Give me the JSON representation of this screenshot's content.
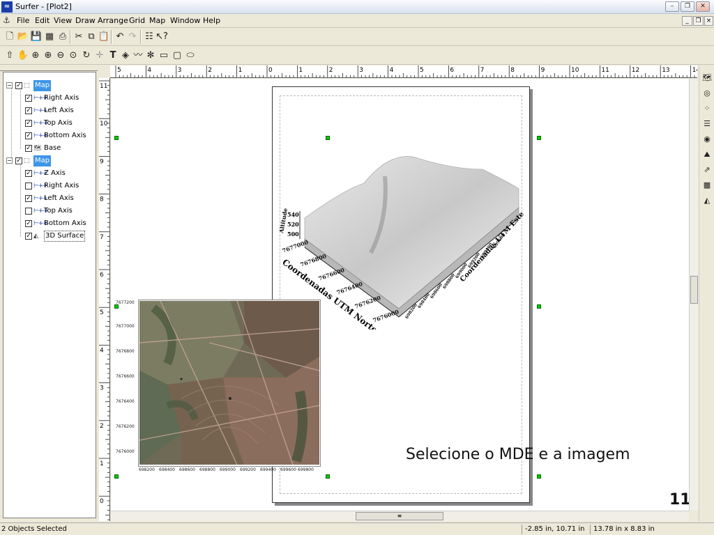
{
  "window": {
    "title": "Surfer - [Plot2]",
    "app_icon": "surfer-logo-icon"
  },
  "menu": [
    "File",
    "Edit",
    "View",
    "Draw",
    "Arrange",
    "Grid",
    "Map",
    "Window",
    "Help"
  ],
  "toolbar1": [
    "new-icon",
    "open-icon",
    "save-icon",
    "worksheet-icon",
    "print-icon",
    "cut-icon",
    "copy-icon",
    "paste-icon",
    "undo-icon",
    "redo-icon",
    "object-manager-icon",
    "help-pointer-icon"
  ],
  "toolbar2": [
    "select-arrow-icon",
    "pan-hand-icon",
    "zoom-in-icon",
    "zoom-in-page-icon",
    "zoom-out-icon",
    "zoom-rect-icon",
    "redraw-icon",
    "digitize-icon",
    "text-icon",
    "polygon-icon",
    "polyline-icon",
    "symbol-icon",
    "rectangle-icon",
    "rounded-rectangle-icon",
    "ellipse-icon"
  ],
  "tree": {
    "map1": {
      "label": "Map",
      "children": [
        "Right Axis",
        "Left Axis",
        "Top Axis",
        "Bottom Axis",
        "Base"
      ]
    },
    "map2": {
      "label": "Map",
      "children": [
        "Z Axis",
        "Right Axis",
        "Left Axis",
        "Top Axis",
        "Bottom Axis",
        "3D Surface"
      ]
    }
  },
  "ruler_top_labels": [
    "5",
    "4",
    "3",
    "2",
    "1",
    "0",
    "1",
    "2",
    "3",
    "4",
    "5",
    "6",
    "7",
    "8",
    "9",
    "10",
    "11",
    "12",
    "13",
    "14"
  ],
  "ruler_left_labels": [
    "11",
    "10",
    "9",
    "8",
    "7",
    "6",
    "5",
    "4",
    "3",
    "2",
    "1",
    "0"
  ],
  "image_map": {
    "y_ticks": [
      "7677200",
      "7677000",
      "7676800",
      "7676600",
      "7676400",
      "7676200",
      "7676000"
    ],
    "x_ticks": [
      "698200",
      "698400",
      "698600",
      "698800",
      "699000",
      "699200",
      "699400",
      "699600",
      "699800"
    ]
  },
  "surface_map": {
    "z_label": "Altitude",
    "z_ticks": [
      "540",
      "520",
      "500"
    ],
    "y_label": "Coordenadas UTM Norte",
    "y_ticks": [
      "7677000",
      "7676800",
      "7676600",
      "7676400",
      "7676200",
      "7676000"
    ],
    "x_label": "Coordenadas UTM Este",
    "x_ticks": [
      "698200",
      "698400",
      "698600",
      "698800",
      "699000",
      "699200",
      "699400",
      "699600"
    ]
  },
  "caption": "Selecione o MDE e a imagem",
  "slide_number": "11",
  "status": {
    "selected": "2 Objects Selected",
    "cursor": "-2.85 in, 10.71 in",
    "size": "13.78 in x 8.83 in"
  }
}
